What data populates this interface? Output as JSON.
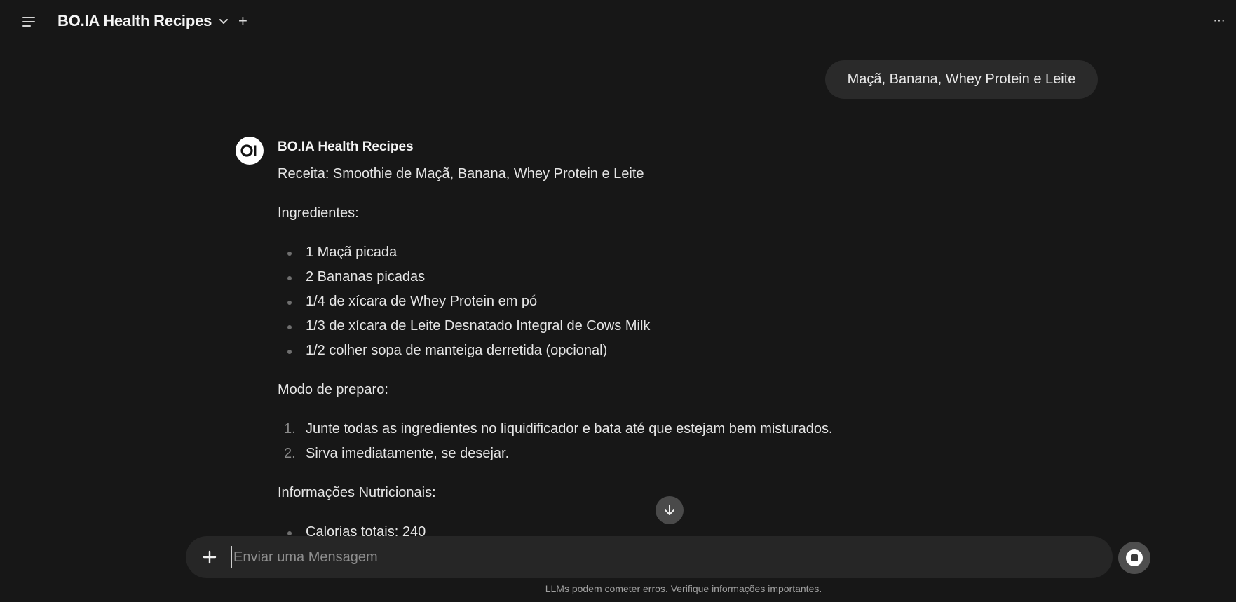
{
  "header": {
    "title": "BO.IA Health Recipes",
    "icons": {
      "menu": "menu-icon",
      "chevron": "chevron-down-icon",
      "new_chat": "plus-icon",
      "more": "more-icon"
    },
    "new_chat_glyph": "+",
    "more_glyph": "···"
  },
  "user_message": "Maçã, Banana, Whey Protein e Leite",
  "assistant": {
    "name": "BO.IA Health Recipes",
    "avatar_text": "OI",
    "recipe_title": "Receita: Smoothie de Maçã, Banana, Whey Protein e Leite",
    "ingredients_heading": "Ingredientes:",
    "ingredients": [
      "1 Maçã picada",
      "2 Bananas picadas",
      "1/4 de xícara de Whey Protein em pó",
      "1/3 de xícara de Leite Desnatado Integral de Cows Milk",
      "1/2 colher sopa de manteiga derretida (opcional)"
    ],
    "steps_heading": "Modo de preparo:",
    "steps": [
      {
        "num": "1.",
        "text": "Junte todas as ingredientes no liquidificador e bata até que estejam bem misturados."
      },
      {
        "num": "2.",
        "text": "Sirva imediatamente, se desejar."
      }
    ],
    "nutrition_heading": "Informações Nutricionais:",
    "nutrition": [
      "Calorias totais: 240"
    ]
  },
  "composer": {
    "placeholder": "Enviar uma Mensagem",
    "value": ""
  },
  "disclaimer": "LLMs podem cometer erros. Verifique informações importantes.",
  "colors": {
    "background": "#171717",
    "bubble": "#2a2a2a",
    "composer": "#262626",
    "text": "#ececec"
  }
}
